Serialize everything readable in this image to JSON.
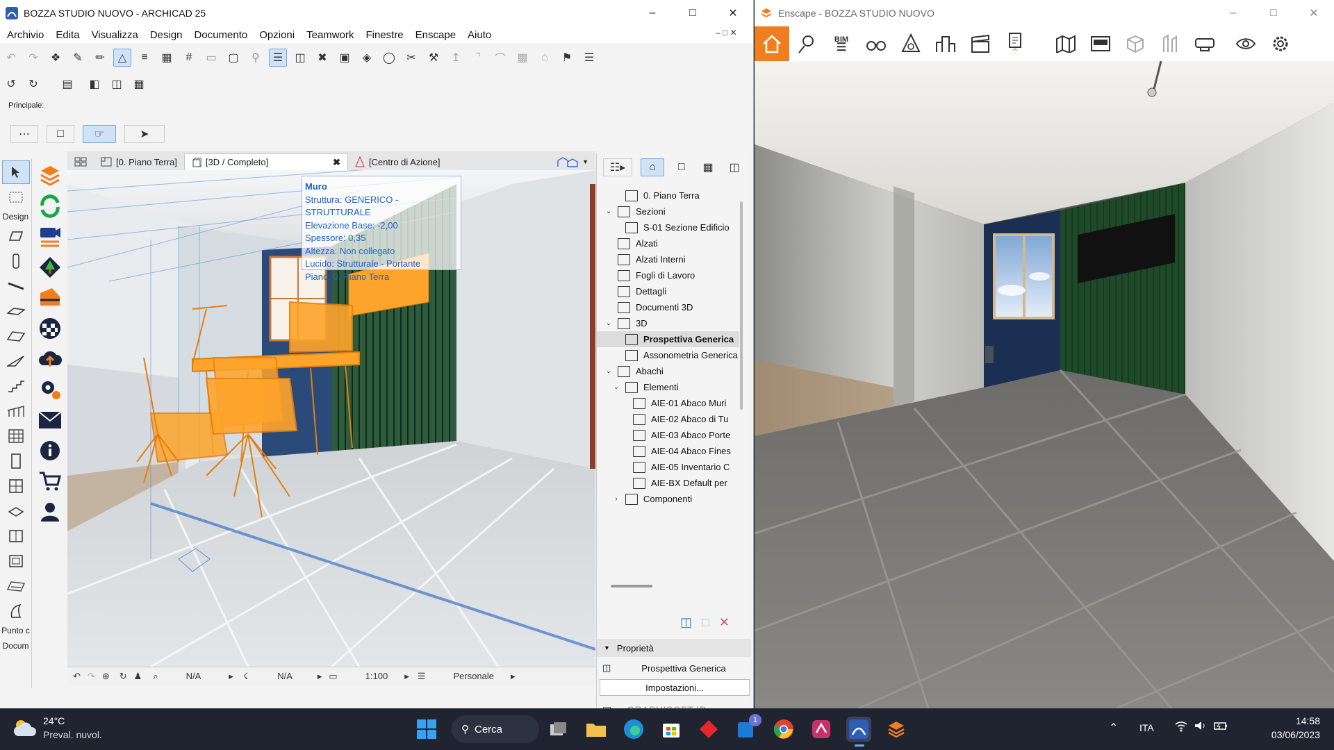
{
  "archicad": {
    "title": "BOZZA STUDIO NUOVO - ARCHICAD 25",
    "menu": [
      "Archivio",
      "Edita",
      "Visualizza",
      "Design",
      "Documento",
      "Opzioni",
      "Teamwork",
      "Finestre",
      "Enscape",
      "Aiuto"
    ],
    "info_box_label": "Principale:",
    "toolbox_labels": {
      "design": "Design",
      "punto": "Punto c",
      "docum": "Docum"
    },
    "tabs": [
      {
        "label": "[0. Piano Terra]"
      },
      {
        "label": "[3D / Completo]"
      },
      {
        "label": "[Centro di Azione]"
      }
    ],
    "tooltip": {
      "title": "Muro",
      "lines": [
        "Struttura: GENERICO - STRUTTURALE",
        "Elevazione Base: -2,00",
        "Spessore: 0,35",
        "Altezza: Non collegato",
        "Lucido: Strutturale - Portante",
        "Piano: 0. Piano Terra"
      ]
    },
    "statusbar": {
      "na1": "N/A",
      "na2": "N/A",
      "scale": "1:100",
      "layer": "Personale"
    },
    "navigator": {
      "items": [
        {
          "label": "0. Piano Terra",
          "level": 1,
          "twisty": ""
        },
        {
          "label": "Sezioni",
          "level": 0,
          "twisty": "v"
        },
        {
          "label": "S-01 Sezione Edificio",
          "level": 1,
          "twisty": ""
        },
        {
          "label": "Alzati",
          "level": 0,
          "twisty": ""
        },
        {
          "label": "Alzati Interni",
          "level": 0,
          "twisty": ""
        },
        {
          "label": "Fogli di Lavoro",
          "level": 0,
          "twisty": ""
        },
        {
          "label": "Dettagli",
          "level": 0,
          "twisty": ""
        },
        {
          "label": "Documenti 3D",
          "level": 0,
          "twisty": ""
        },
        {
          "label": "3D",
          "level": 0,
          "twisty": "v"
        },
        {
          "label": "Prospettiva Generica",
          "level": 1,
          "twisty": "",
          "selected": true
        },
        {
          "label": "Assonometria Generica",
          "level": 1,
          "twisty": ""
        },
        {
          "label": "Abachi",
          "level": 0,
          "twisty": "v"
        },
        {
          "label": "Elementi",
          "level": 1,
          "twisty": "v"
        },
        {
          "label": "AIE-01 Abaco Muri",
          "level": 2,
          "twisty": ""
        },
        {
          "label": "AIE-02 Abaco di Tu",
          "level": 2,
          "twisty": ""
        },
        {
          "label": "AIE-03 Abaco Porte",
          "level": 2,
          "twisty": ""
        },
        {
          "label": "AIE-04 Abaco Fines",
          "level": 2,
          "twisty": ""
        },
        {
          "label": "AIE-05 Inventario C",
          "level": 2,
          "twisty": ""
        },
        {
          "label": "AIE-BX Default per",
          "level": 2,
          "twisty": ""
        },
        {
          "label": "Componenti",
          "level": 1,
          "twisty": ">"
        }
      ],
      "properties_header": "Proprietà",
      "properties_value": "Prospettiva Generica",
      "settings_button": "Impostazioni...",
      "graphisoft_id": "GRAPHISOFT ID"
    }
  },
  "enscape": {
    "title": "Enscape - BOZZA STUDIO NUOVO",
    "bim_label": "BIM"
  },
  "taskbar": {
    "weather_temp": "24°C",
    "weather_desc": "Preval. nuvol.",
    "search_label": "Cerca",
    "badge_count": "1",
    "language": "ITA",
    "time": "14:58",
    "date": "03/06/2023"
  },
  "colors": {
    "accent_orange": "#f07e1e",
    "selection_blue": "#1d64c6",
    "object_orange": "#ffa42b",
    "wall_green": "#1f4a2a",
    "wall_navy": "#1a2f52"
  }
}
